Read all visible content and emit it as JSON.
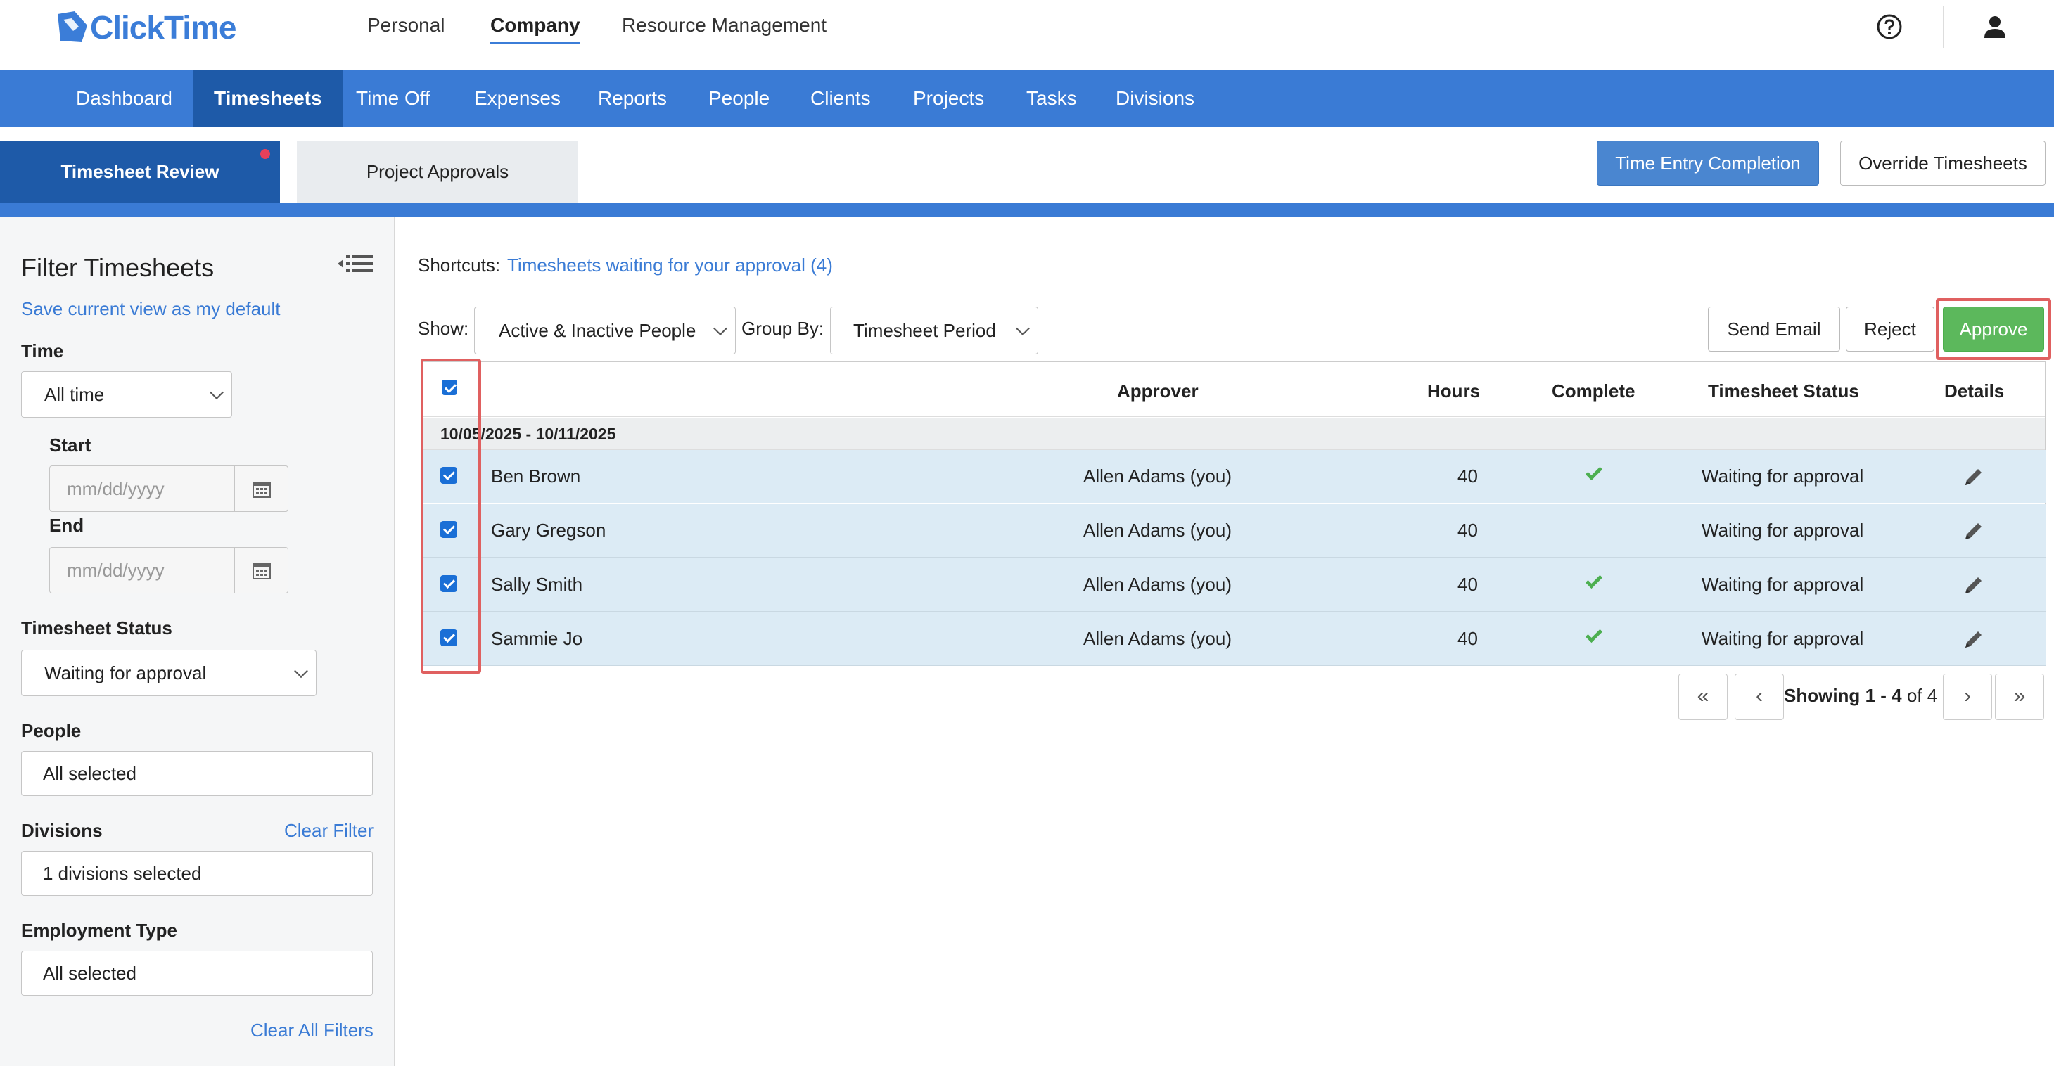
{
  "app": {
    "logo": "ClickTime",
    "top_nav": [
      "Personal",
      "Company",
      "Resource Management"
    ],
    "active_top": "Company"
  },
  "main_nav": [
    "Dashboard",
    "Timesheets",
    "Time Off",
    "Expenses",
    "Reports",
    "People",
    "Clients",
    "Projects",
    "Tasks",
    "Divisions"
  ],
  "active_main": "Timesheets",
  "sub_tabs": {
    "review": "Timesheet Review",
    "projects": "Project Approvals"
  },
  "header_buttons": {
    "completion": "Time Entry Completion",
    "override": "Override Timesheets"
  },
  "sidebar": {
    "title": "Filter Timesheets",
    "save_link": "Save current view as my default",
    "time_label": "Time",
    "time_value": "All time",
    "start_label": "Start",
    "end_label": "End",
    "date_placeholder": "mm/dd/yyyy",
    "status_label": "Timesheet Status",
    "status_value": "Waiting for approval",
    "people_label": "People",
    "people_value": "All selected",
    "divisions_label": "Divisions",
    "clear_filter": "Clear Filter",
    "divisions_value": "1 divisions selected",
    "employment_label": "Employment Type",
    "employment_value": "All selected",
    "clear_all": "Clear All Filters"
  },
  "main": {
    "shortcuts_label": "Shortcuts:",
    "shortcuts_link": "Timesheets waiting for your approval (4)",
    "show_label": "Show:",
    "show_value": "Active & Inactive People",
    "group_label": "Group By:",
    "group_value": "Timesheet Period",
    "send_email": "Send Email",
    "reject": "Reject",
    "approve": "Approve"
  },
  "table": {
    "headers": {
      "approver": "Approver",
      "hours": "Hours",
      "complete": "Complete",
      "status": "Timesheet Status",
      "details": "Details"
    },
    "group": "10/05/2025 - 10/11/2025",
    "rows": [
      {
        "name": "Ben Brown",
        "approver": "Allen Adams (you)",
        "hours": "40",
        "complete": true,
        "status": "Waiting for approval"
      },
      {
        "name": "Gary Gregson",
        "approver": "Allen Adams (you)",
        "hours": "40",
        "complete": false,
        "status": "Waiting for approval"
      },
      {
        "name": "Sally Smith",
        "approver": "Allen Adams (you)",
        "hours": "40",
        "complete": true,
        "status": "Waiting for approval"
      },
      {
        "name": "Sammie Jo",
        "approver": "Allen Adams (you)",
        "hours": "40",
        "complete": true,
        "status": "Waiting for approval"
      }
    ]
  },
  "pagination": {
    "showing": "Showing",
    "range": "1 - 4",
    "of": "of 4"
  }
}
